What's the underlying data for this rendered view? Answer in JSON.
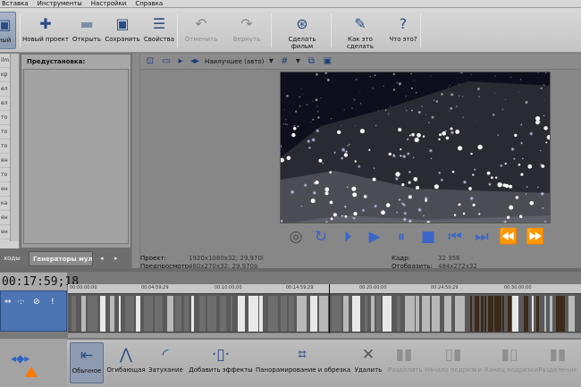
{
  "menu": [
    "Вставка",
    "Инструменты",
    "Настройки",
    "Справка"
  ],
  "toolbar": {
    "partial_left": "ный",
    "new_project": "Новый проект",
    "open": "Открыть",
    "save": "Сохранить",
    "properties": "Свойства",
    "undo": "Отменить",
    "redo": "Вернуть",
    "make_movie": "Сделать фильм",
    "how_to": "Как это сделать",
    "whats_this": "Что это?"
  },
  "left_strip": [
    "ilm",
    "кр",
    "ел",
    "ел",
    "то",
    "то",
    "то",
    "ен",
    "то",
    "ен",
    "ка",
    "ен",
    "ен"
  ],
  "preset": {
    "header": "Предустановка:"
  },
  "tabs": {
    "left": "ходы",
    "generators": "Генераторы муль"
  },
  "preview": {
    "quality": "Наилучшее (авто)"
  },
  "info": {
    "project_label": "Проект:",
    "project_value": "1920x1080x32; 29,970i",
    "preview_label": "Предпросмотр:",
    "preview_value": "480x270x32; 29,970p",
    "frame_label": "Кадр:",
    "frame_value": "32 356",
    "display_label": "Отобразить:",
    "display_value": "484x272x32"
  },
  "timecode": "00:17:59;18",
  "ruler": [
    "00:00:00;00",
    "00:04:59;29",
    "00:10:00;00",
    "00:14:59;29",
    "00:20:00;00",
    "00:24:59;29",
    "00:30:00;00"
  ],
  "bottom": {
    "normal": "Обычное",
    "envelope": "Огибающая",
    "fade": "Затухание",
    "add_effects": "Добавить эффекты",
    "pan_crop": "Панорамирование и обрезка",
    "delete": "Удалить",
    "split": "Разделить",
    "trim_start": "Начало подрезки",
    "trim_end": "Конец подрезки",
    "split2": "Разделение"
  },
  "colors": {
    "accent": "#3a66c8",
    "track_head": "#4d75b3",
    "marker": "#ff8c00"
  }
}
